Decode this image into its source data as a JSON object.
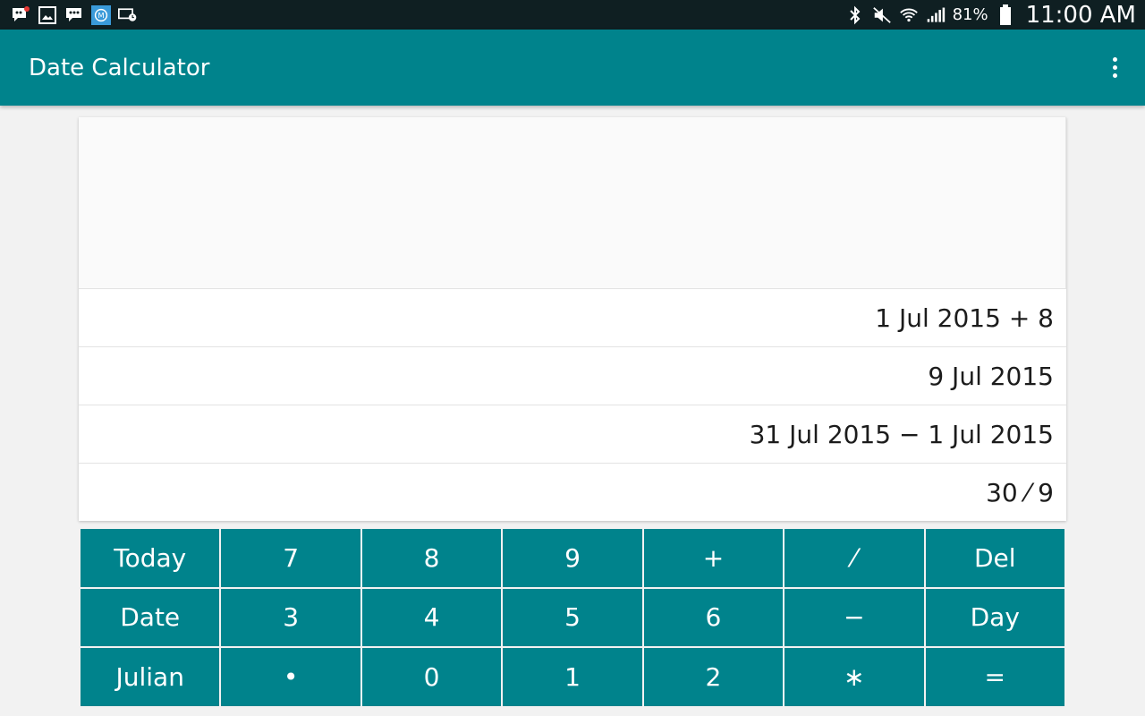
{
  "status_bar": {
    "battery": "81%",
    "time": "11:00 AM",
    "left_icons": [
      "bbm-notification-icon",
      "gallery-icon",
      "bbm-icon",
      "messenger-icon",
      "cast-alarm-icon"
    ],
    "right_icons": [
      "bluetooth-icon",
      "mute-icon",
      "wifi-icon",
      "signal-icon",
      "battery-icon"
    ]
  },
  "app_bar": {
    "title": "Date Calculator",
    "menu_icon": "overflow-menu-icon"
  },
  "history": [
    "1 Jul 2015 + 8",
    "9 Jul 2015",
    "31 Jul 2015 − 1 Jul 2015",
    "30 ⁄ 9"
  ],
  "keypad": {
    "rows": [
      [
        "Today",
        "7",
        "8",
        "9",
        "+",
        "⁄",
        "Del"
      ],
      [
        "Date",
        "3",
        "4",
        "5",
        "6",
        "−",
        "Day"
      ],
      [
        "Julian",
        "•",
        "0",
        "1",
        "2",
        "∗",
        "="
      ]
    ]
  },
  "colors": {
    "primary": "#00838c",
    "status_bar": "#0f1f22",
    "background": "#f2f2f2"
  }
}
